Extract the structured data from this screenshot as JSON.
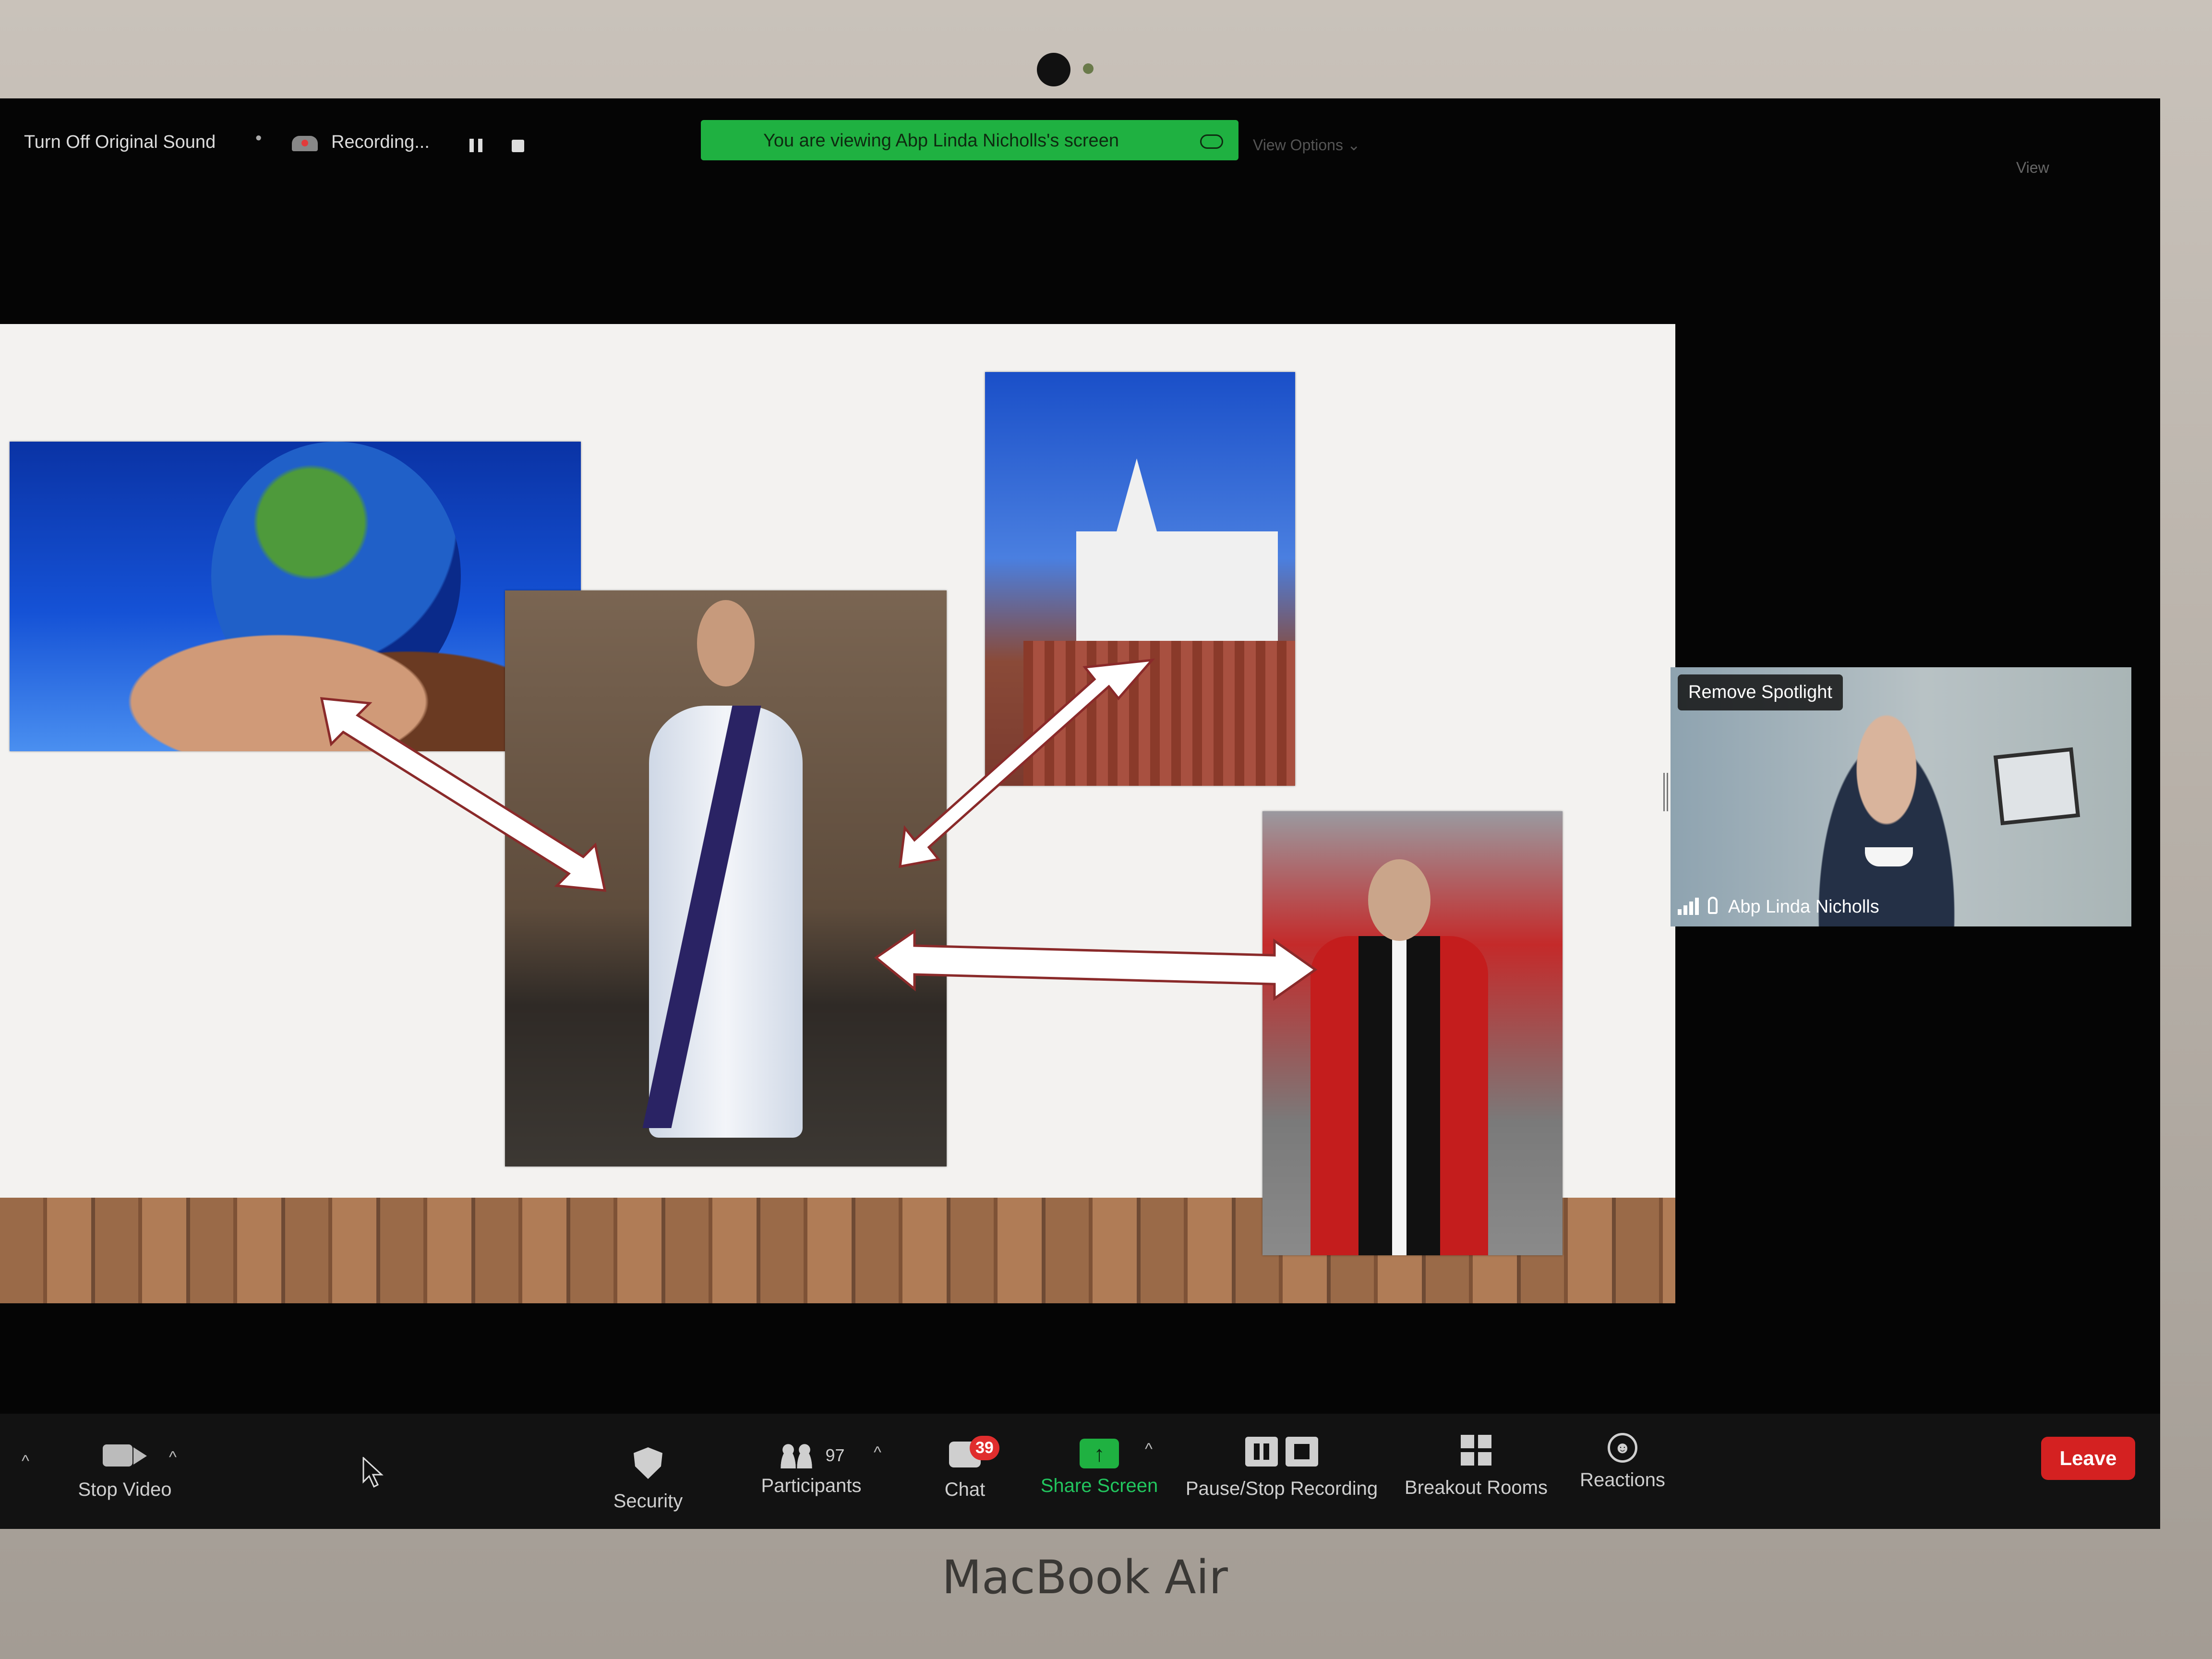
{
  "device": {
    "brand": "MacBook Air"
  },
  "top_bar": {
    "original_sound": "Turn Off Original Sound",
    "separator": "•",
    "recording_label": "Recording...",
    "viewing_banner": "You are viewing Abp Linda Nicholls's screen",
    "view_options": "View Options ⌄",
    "view": "View"
  },
  "participant_tile": {
    "remove_spotlight": "Remove Spotlight",
    "name": "Abp Linda Nicholls"
  },
  "toolbar": {
    "stop_video": "Stop Video",
    "security": "Security",
    "participants": "Participants",
    "participant_count": "97",
    "chat": "Chat",
    "chat_badge": "39",
    "share_screen": "Share Screen",
    "pause_stop_recording": "Pause/Stop Recording",
    "breakout_rooms": "Breakout Rooms",
    "reactions": "Reactions",
    "leave": "Leave"
  },
  "icons": {
    "share": "↑",
    "caret": "^",
    "reactions": "☻"
  },
  "colors": {
    "banner_green": "#1fb141",
    "leave_red": "#d42121",
    "badge_red": "#e02d2d"
  }
}
